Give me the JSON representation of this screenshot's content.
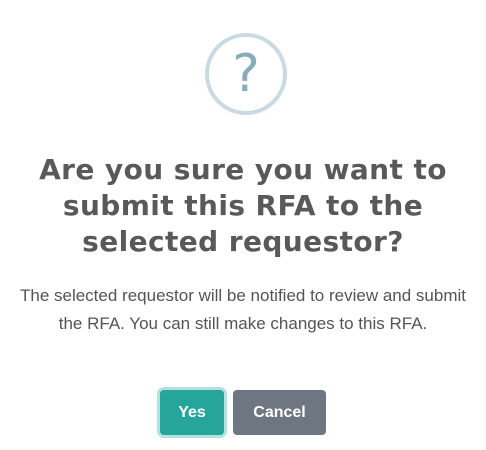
{
  "dialog": {
    "icon": "question-mark-icon",
    "icon_glyph": "?",
    "title": "Are you sure you want to submit this RFA to the selected requestor?",
    "message": "The selected requestor will be notified to review and submit the RFA. You can still make changes to this RFA.",
    "confirm_label": "Yes",
    "cancel_label": "Cancel"
  },
  "colors": {
    "icon_ring": "#c9dae1",
    "icon_glyph": "#87adbd",
    "confirm_button": "#26a69a",
    "cancel_button": "#6e7781",
    "title_text": "#595959"
  }
}
